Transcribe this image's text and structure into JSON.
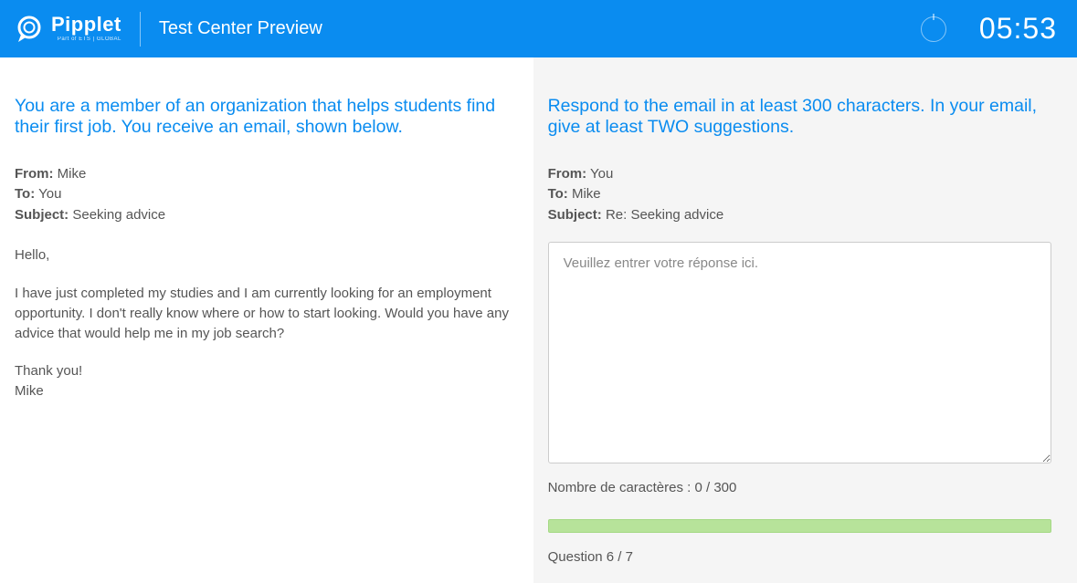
{
  "header": {
    "brand": "Pipplet",
    "brand_sub": "Part of ETS | GLOBAL",
    "title": "Test Center Preview",
    "timer": "05:53"
  },
  "left": {
    "prompt": "You are a member of an organization that helps students find their first job. You receive an email, shown below.",
    "email_meta": {
      "from_label": "From:",
      "from_value": "Mike",
      "to_label": "To:",
      "to_value": "You",
      "subj_label": "Subject:",
      "subj_value": "Seeking advice"
    },
    "body": {
      "p1": "Hello,",
      "p2": "I have just completed my studies and I am currently looking for an employment opportunity. I don't really know where or how to start looking. Would you have any advice that would help me in my job search?",
      "p3a": "Thank you!",
      "p3b": "Mike"
    }
  },
  "right": {
    "prompt": "Respond to the email in at least 300 characters. In your email, give at least TWO suggestions.",
    "email_meta": {
      "from_label": "From:",
      "from_value": "You",
      "to_label": "To:",
      "to_value": "Mike",
      "subj_label": "Subject:",
      "subj_value": "Re: Seeking advice"
    },
    "placeholder": "Veuillez entrer votre réponse ici.",
    "char_count": "Nombre de caractères : 0 / 300",
    "question_label": "Question 6 / 7"
  }
}
